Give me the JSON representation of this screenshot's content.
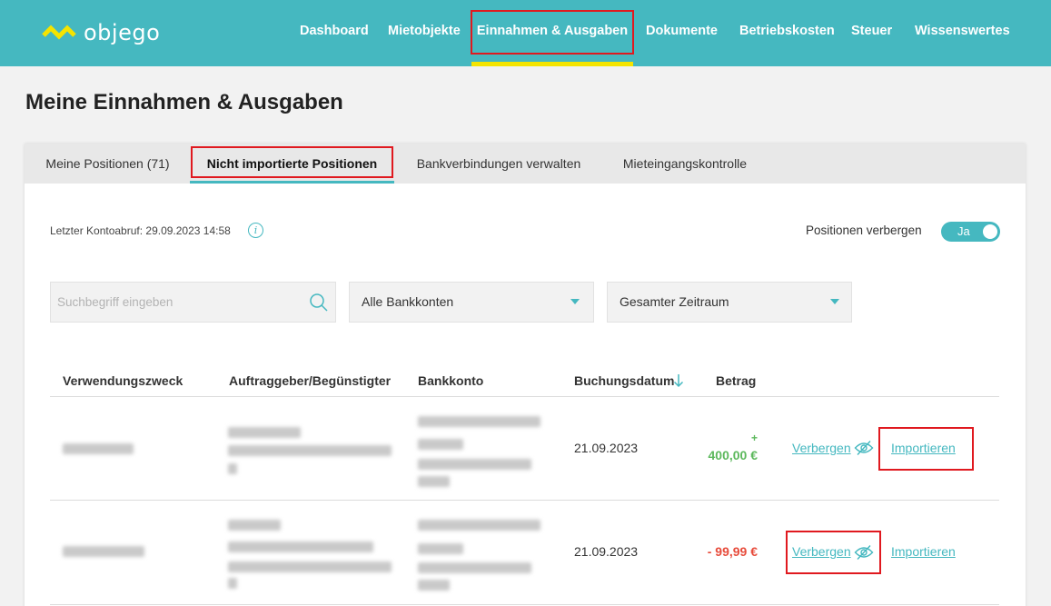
{
  "header": {
    "logo_text": "objego",
    "nav": [
      {
        "label": "Dashboard"
      },
      {
        "label": "Mietobjekte"
      },
      {
        "label": "Einnahmen & Ausgaben"
      },
      {
        "label": "Dokumente"
      },
      {
        "label": "Betriebskosten"
      },
      {
        "label": "Steuer"
      },
      {
        "label": "Wissenswertes"
      }
    ],
    "active_nav": "Einnahmen & Ausgaben"
  },
  "page": {
    "title": "Meine Einnahmen & Ausgaben"
  },
  "tabs": [
    {
      "label": "Meine Positionen (71)"
    },
    {
      "label": "Nicht importierte Positionen"
    },
    {
      "label": "Bankverbindungen verwalten"
    },
    {
      "label": "Mieteingangskontrolle"
    }
  ],
  "active_tab": "Nicht importierte Positionen",
  "toolbar": {
    "last_fetch": "Letzter Kontoabruf: 29.09.2023 14:58",
    "hide_label": "Positionen verbergen",
    "hide_toggle": "Ja"
  },
  "filters": {
    "search_placeholder": "Suchbegriff eingeben",
    "account_select": "Alle Bankkonten",
    "period_select": "Gesamter Zeitraum"
  },
  "table": {
    "columns": [
      "Verwendungszweck",
      "Auftraggeber/Begünstigter",
      "Bankkonto",
      "Buchungsdatum",
      "Betrag"
    ],
    "rows": [
      {
        "date": "21.09.2023",
        "amount_sign": "+",
        "amount": "400,00 €",
        "hide": "Verbergen",
        "import": "Importieren"
      },
      {
        "date": "21.09.2023",
        "amount": "- 99,99 €",
        "hide": "Verbergen",
        "import": "Importieren"
      }
    ]
  },
  "colors": {
    "brand": "#45b8c0",
    "accent_underline": "#f5e400",
    "highlight": "#e0191f",
    "positive": "#5cb85c",
    "negative": "#e74c3c"
  }
}
